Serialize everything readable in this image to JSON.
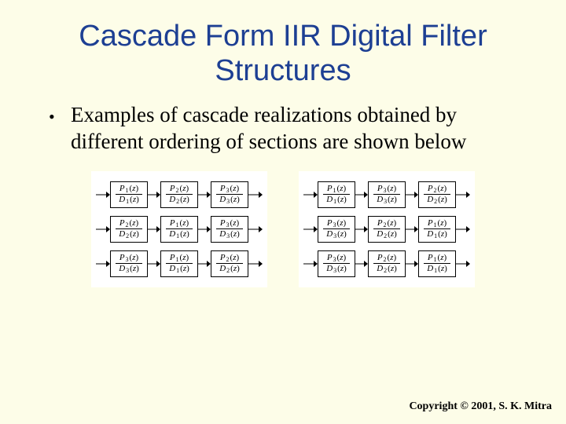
{
  "title": "Cascade Form IIR Digital Filter Structures",
  "bullet": "Examples of cascade realizations obtained by different ordering of sections are shown below",
  "copyright": "Copyright © 2001, S. K. Mitra",
  "diagram": {
    "left": [
      [
        [
          1,
          1
        ],
        [
          2,
          2
        ],
        [
          3,
          3
        ]
      ],
      [
        [
          2,
          2
        ],
        [
          1,
          1
        ],
        [
          3,
          3
        ]
      ],
      [
        [
          3,
          3
        ],
        [
          1,
          1
        ],
        [
          2,
          2
        ]
      ]
    ],
    "right": [
      [
        [
          1,
          1
        ],
        [
          3,
          3
        ],
        [
          2,
          2
        ]
      ],
      [
        [
          3,
          3
        ],
        [
          2,
          2
        ],
        [
          1,
          1
        ]
      ],
      [
        [
          3,
          3
        ],
        [
          2,
          2
        ],
        [
          1,
          1
        ]
      ]
    ]
  }
}
